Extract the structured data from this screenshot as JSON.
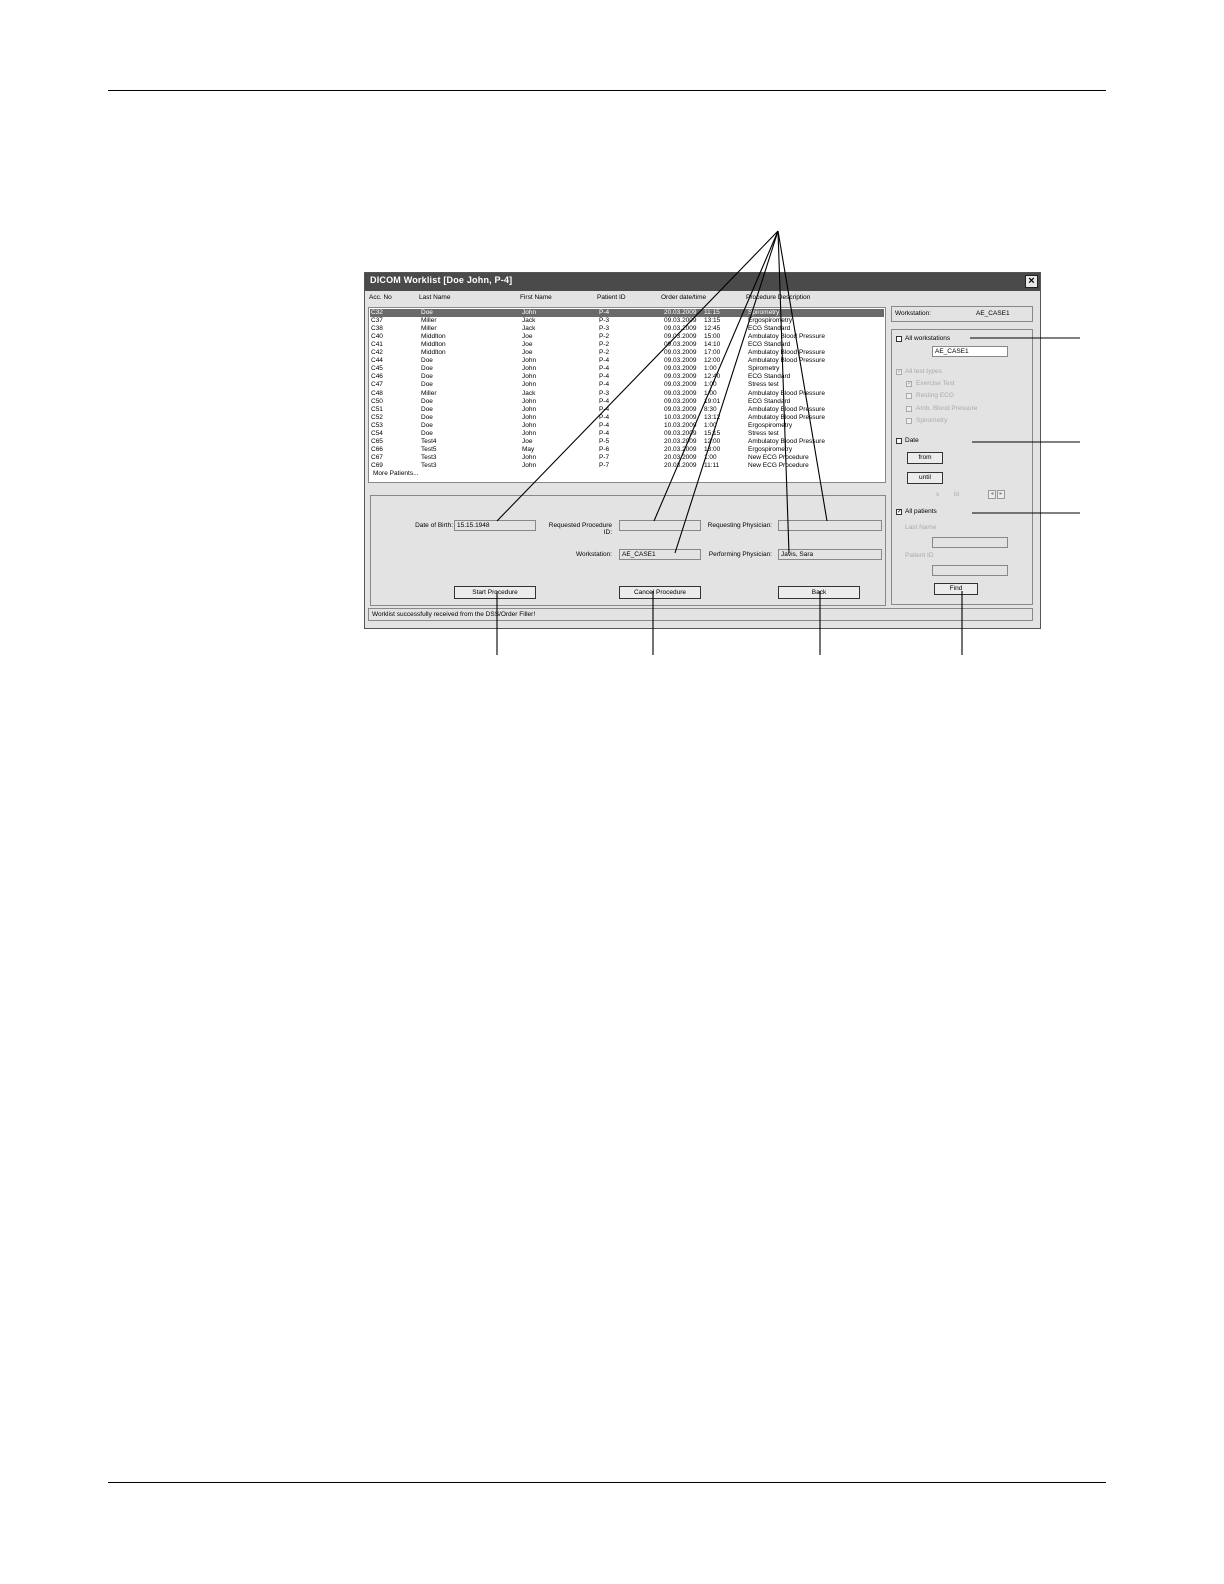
{
  "window": {
    "title": "DICOM Worklist [Doe John, P-4]",
    "close_icon": "close-icon"
  },
  "columns": [
    "Acc. No",
    "Last Name",
    "First Name",
    "Patient ID",
    "Order date/time",
    "Procedure Description"
  ],
  "rows": [
    {
      "acc": "C32",
      "last": "Doe",
      "first": "John",
      "pid": "P-4",
      "date": "20.03.2009",
      "time": "11:15",
      "proc": "Spirometry",
      "selected": true
    },
    {
      "acc": "C37",
      "last": "Miller",
      "first": "Jack",
      "pid": "P-3",
      "date": "09.03.2009",
      "time": "13:15",
      "proc": "Ergospirometry"
    },
    {
      "acc": "C38",
      "last": "Miller",
      "first": "Jack",
      "pid": "P-3",
      "date": "09.03.2009",
      "time": "12:45",
      "proc": "ECG Standard"
    },
    {
      "acc": "C40",
      "last": "Middlton",
      "first": "Joe",
      "pid": "P-2",
      "date": "09.03.2009",
      "time": "15:00",
      "proc": "Ambulatoy Blood Pressure"
    },
    {
      "acc": "C41",
      "last": "Middlton",
      "first": "Joe",
      "pid": "P-2",
      "date": "09.03.2009",
      "time": "14:10",
      "proc": "ECG Standard"
    },
    {
      "acc": "C42",
      "last": "Middlton",
      "first": "Joe",
      "pid": "P-2",
      "date": "09.03.2009",
      "time": "17:00",
      "proc": "Ambulatoy Blood Pressure"
    },
    {
      "acc": "C44",
      "last": "Doe",
      "first": "John",
      "pid": "P-4",
      "date": "09.03.2009",
      "time": "12:00",
      "proc": "Ambulatoy Blood Pressure"
    },
    {
      "acc": "C45",
      "last": "Doe",
      "first": "John",
      "pid": "P-4",
      "date": "09.03.2009",
      "time": "1:00",
      "proc": "Spirometry"
    },
    {
      "acc": "C46",
      "last": "Doe",
      "first": "John",
      "pid": "P-4",
      "date": "09.03.2009",
      "time": "12:40",
      "proc": "ECG Standard"
    },
    {
      "acc": "C47",
      "last": "Doe",
      "first": "John",
      "pid": "P-4",
      "date": "09.03.2009",
      "time": "1:00",
      "proc": "Stress test"
    },
    {
      "acc": "C48",
      "last": "Miller",
      "first": "Jack",
      "pid": "P-3",
      "date": "09.03.2009",
      "time": "1:00",
      "proc": "Ambulatoy Blood Pressure"
    },
    {
      "acc": "C50",
      "last": "Doe",
      "first": "John",
      "pid": "P-4",
      "date": "09.03.2009",
      "time": "19:01",
      "proc": "ECG Standard"
    },
    {
      "acc": "C51",
      "last": "Doe",
      "first": "John",
      "pid": "P-4",
      "date": "09.03.2009",
      "time": "8:30",
      "proc": "Ambulatoy Blood Pressure"
    },
    {
      "acc": "C52",
      "last": "Doe",
      "first": "John",
      "pid": "P-4",
      "date": "10.03.2009",
      "time": "13:12",
      "proc": "Ambulatoy Blood Pressure"
    },
    {
      "acc": "C53",
      "last": "Doe",
      "first": "John",
      "pid": "P-4",
      "date": "10.03.2009",
      "time": "1:00",
      "proc": "Ergospirometry"
    },
    {
      "acc": "C54",
      "last": "Doe",
      "first": "John",
      "pid": "P-4",
      "date": "09.03.2009",
      "time": "15:15",
      "proc": "Stress test"
    },
    {
      "acc": "C65",
      "last": "Test4",
      "first": "Joe",
      "pid": "P-5",
      "date": "20.03.2009",
      "time": "12:00",
      "proc": "Ambulatoy Blood Pressure"
    },
    {
      "acc": "C66",
      "last": "Test5",
      "first": "May",
      "pid": "P-6",
      "date": "20.03.2009",
      "time": "13:00",
      "proc": "Ergospirometry"
    },
    {
      "acc": "C67",
      "last": "Test3",
      "first": "John",
      "pid": "P-7",
      "date": "20.03.2009",
      "time": "1:00",
      "proc": "New ECG Procedure"
    },
    {
      "acc": "C69",
      "last": "Test3",
      "first": "John",
      "pid": "P-7",
      "date": "20.03.2009",
      "time": "11:11",
      "proc": "New ECG Procedure"
    }
  ],
  "more_patients": "More Patients...",
  "details": {
    "dob_label": "Date of Birth:",
    "dob_value": "15.15.1948",
    "req_proc_label_1": "Requested Procedure",
    "req_proc_label_2": "ID:",
    "req_proc_value": "",
    "req_phys_label": "Requesting Physician:",
    "req_phys_value": "",
    "workstation_label": "Workstation:",
    "workstation_value": "AE_CASE1",
    "perf_phys_label": "Performing Physician:",
    "perf_phys_value": "Javis, Sara"
  },
  "buttons": {
    "start": "Start Procedure",
    "cancel": "Cancel Procedure",
    "back": "Back",
    "find": "Find"
  },
  "status": "Worklist successfully received from the DSS/Order Filler!",
  "filters": {
    "workstation_label": "Workstation:",
    "workstation_value": "AE_CASE1",
    "all_workstations": "All workstations",
    "all_workstations_checked": false,
    "ws_field_value": "AE_CASE1",
    "all_test_types": "All test types",
    "test_types": [
      "Exercise Test",
      "Resting ECG",
      "Amb. Blood Pressure",
      "Spirometry"
    ],
    "date_label": "Date",
    "date_checked": false,
    "from_button": "from",
    "until_button": "until",
    "page_text_a": "s",
    "page_text_b": "bi",
    "prev_icon": "chevron-left-icon",
    "next_icon": "chevron-right-icon",
    "all_patients": "All patients",
    "all_patients_checked": true,
    "last_name_label": "Last Name",
    "last_name_value": "",
    "patient_id_label": "Patient ID",
    "patient_id_value": ""
  }
}
